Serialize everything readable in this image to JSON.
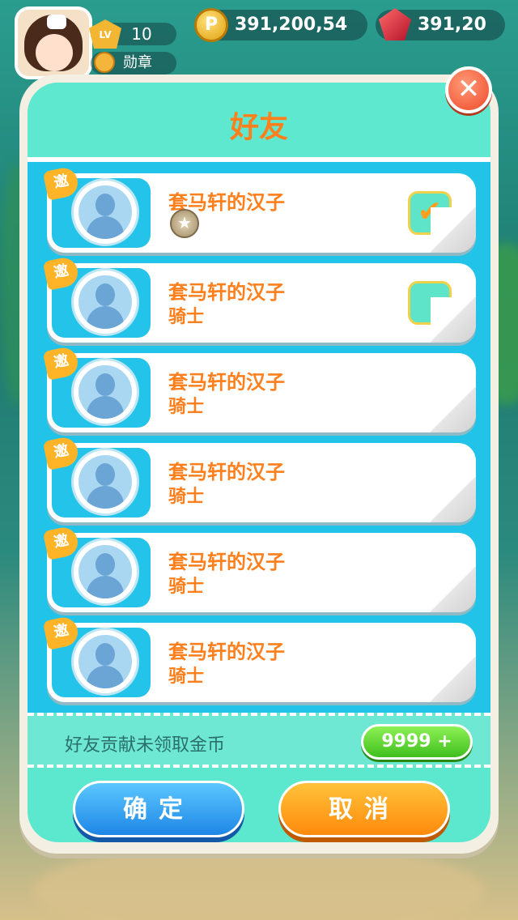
{
  "hud": {
    "level_label": "LV",
    "level_value": "10",
    "medal_label": "勋章",
    "coins": "391,200,54",
    "coin_icon": "P",
    "gems": "391,20"
  },
  "modal": {
    "title": "好友",
    "close_icon": "close-icon",
    "invite_badge": "邀",
    "friends": [
      {
        "name": "套马轩的汉子",
        "rank": "",
        "rank_icon": "star-medal-icon",
        "checked": true
      },
      {
        "name": "套马轩的汉子",
        "rank": "骑士",
        "checked": false
      },
      {
        "name": "套马轩的汉子",
        "rank": "骑士"
      },
      {
        "name": "套马轩的汉子",
        "rank": "骑士"
      },
      {
        "name": "套马轩的汉子",
        "rank": "骑士"
      },
      {
        "name": "套马轩的汉子",
        "rank": "骑士"
      }
    ],
    "check_mark": "✔",
    "info_text": "好友贡献未领取金币",
    "coin_button": "9999 +",
    "confirm_label": "确定",
    "cancel_label": "取消"
  },
  "colors": {
    "accent_orange": "#ff7f1c",
    "list_blue": "#22c3e8",
    "panel_mint": "#5ce7cf",
    "confirm_blue": "#1e86e6",
    "cancel_orange": "#ff8a0c",
    "coin_green": "#3fbf1e"
  }
}
